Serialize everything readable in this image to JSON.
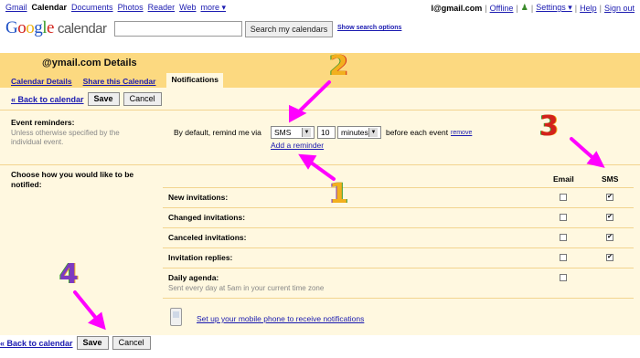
{
  "top_nav": {
    "apps": [
      "Gmail",
      "Calendar",
      "Documents",
      "Photos",
      "Reader",
      "Web",
      "more ▾"
    ],
    "account": "l@gmail.com",
    "links": [
      "Offline",
      "Settings ▾",
      "Help",
      "Sign out"
    ]
  },
  "header": {
    "logo_letters": [
      "G",
      "o",
      "o",
      "g",
      "l",
      "e"
    ],
    "logo_product": "calendar",
    "search_button": "Search my calendars",
    "search_options": "Show search options",
    "search_value": ""
  },
  "details": {
    "title": "@ymail.com Details",
    "tabs": [
      "Calendar Details",
      "Share this Calendar",
      "Notifications"
    ],
    "active_tab": "Notifications"
  },
  "actions": {
    "back_link": "« Back to calendar",
    "save": "Save",
    "cancel": "Cancel"
  },
  "event_reminders": {
    "label": "Event reminders:",
    "description": "Unless otherwise specified by the individual event.",
    "default_text": "By default, remind me via",
    "method": "SMS",
    "amount": "10",
    "unit": "minutes",
    "after_text": "before each event",
    "remove": "remove",
    "add": "Add a reminder"
  },
  "notifications": {
    "label": "Choose how you would like to be notified:",
    "col_email": "Email",
    "col_sms": "SMS",
    "rows": [
      {
        "label": "New invitations:",
        "email": false,
        "sms": true
      },
      {
        "label": "Changed invitations:",
        "email": false,
        "sms": true
      },
      {
        "label": "Canceled invitations:",
        "email": false,
        "sms": true
      },
      {
        "label": "Invitation replies:",
        "email": false,
        "sms": true
      },
      {
        "label": "Daily agenda:",
        "email": false,
        "sms": null
      }
    ],
    "daily_desc": "Sent every day at 5am in your current time zone"
  },
  "mobile": {
    "link": "Set up your mobile phone to receive notifications"
  },
  "annotations": [
    "1",
    "2",
    "3",
    "4"
  ],
  "colors": {
    "band": "#fcd980",
    "panel": "#fff8e0",
    "link": "#1a1ab0",
    "arrow": "#ff00ff"
  }
}
